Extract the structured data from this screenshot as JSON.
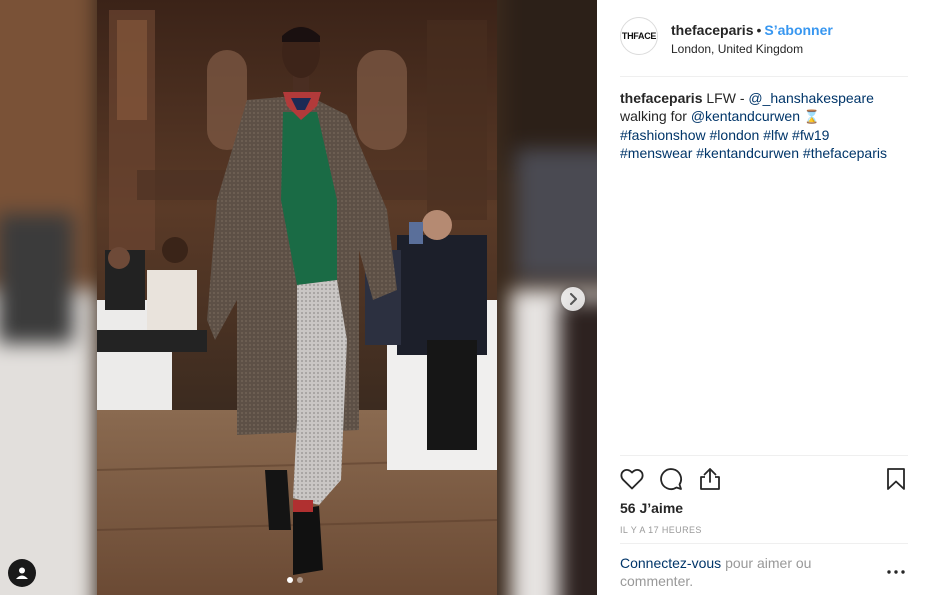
{
  "post": {
    "username": "thefaceparis",
    "separator": "•",
    "follow_label": "S’abonner",
    "location": "London, United Kingdom",
    "avatar_text": "THFACE"
  },
  "caption": {
    "username": "thefaceparis",
    "text_1": "LFW -",
    "mention_1": "@_hanshakespeare",
    "text_2": "walking for",
    "mention_2": "@kentandcurwen",
    "emoji": "⌛",
    "hashtags": [
      "#fashionshow",
      "#london",
      "#lfw",
      "#fw19",
      "#menswear",
      "#kentandcurwen",
      "#thefaceparis"
    ]
  },
  "stats": {
    "likes": "56 J’aime",
    "time": "IL Y A 17 HEURES"
  },
  "comment": {
    "login_label": "Connectez-vous",
    "rest": "pour aimer ou commenter."
  },
  "carousel": {
    "total": 2,
    "current": 1
  },
  "icons": {
    "like": "heart-icon",
    "comment": "comment-bubble-icon",
    "share": "share-icon",
    "save": "bookmark-icon",
    "more": "more-dots-icon",
    "next": "chevron-right-icon",
    "tag": "user-tag-icon"
  },
  "colors": {
    "accent": "#3897f0",
    "link": "#003569",
    "muted": "#999999",
    "divider": "#efefef"
  }
}
